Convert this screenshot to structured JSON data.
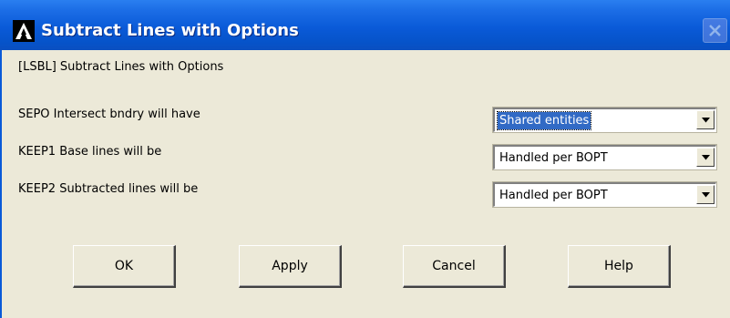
{
  "window": {
    "title": "Subtract Lines with Options",
    "logo_icon": "ansys-logo-icon",
    "close_icon": "close-icon"
  },
  "command_label": "[LSBL]  Subtract Lines with Options",
  "fields": [
    {
      "label": "SEPO  Intersect bndry will have",
      "value": "Shared entities",
      "selected": true
    },
    {
      "label": "KEEP1  Base lines will be",
      "value": "Handled per BOPT",
      "selected": false
    },
    {
      "label": "KEEP2  Subtracted lines will be",
      "value": "Handled per BOPT",
      "selected": false
    }
  ],
  "buttons": {
    "ok": "OK",
    "apply": "Apply",
    "cancel": "Cancel",
    "help": "Help"
  },
  "colors": {
    "titlebar": "#0a5ad8",
    "dialog_bg": "#ece9d8",
    "selection": "#316ac5"
  }
}
